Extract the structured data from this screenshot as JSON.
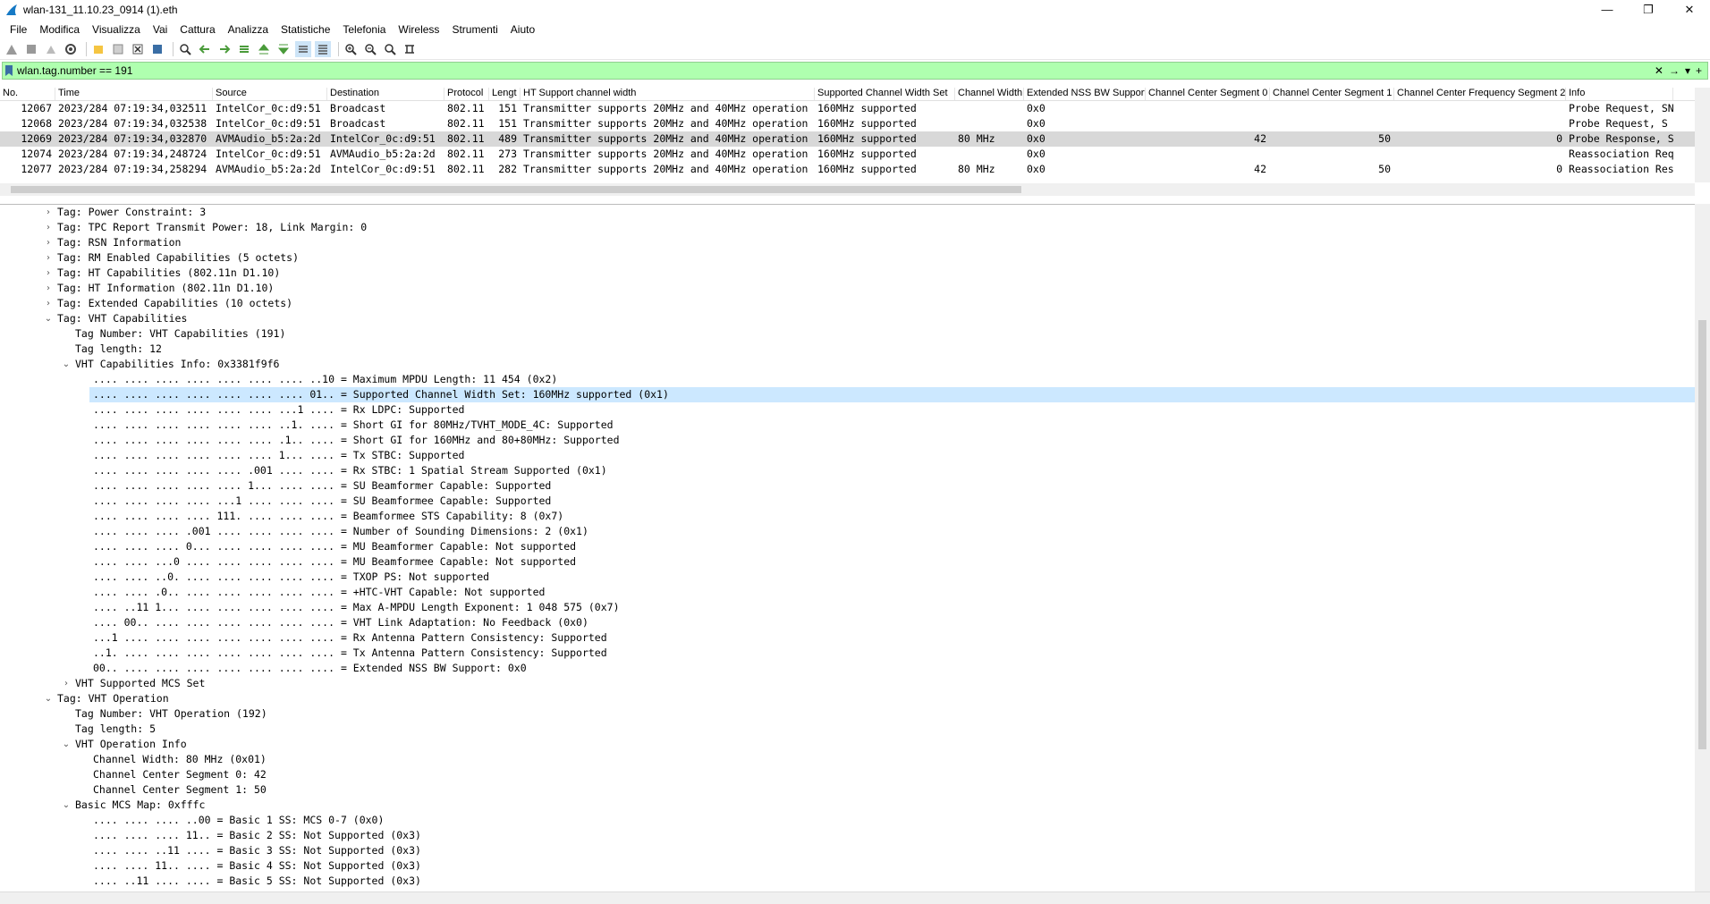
{
  "window": {
    "title": "wlan-131_11.10.23_0914 (1).eth",
    "minimize": "—",
    "restore": "❐",
    "close": "✕"
  },
  "menu": [
    "File",
    "Modifica",
    "Visualizza",
    "Vai",
    "Cattura",
    "Analizza",
    "Statistiche",
    "Telefonia",
    "Wireless",
    "Strumenti",
    "Aiuto"
  ],
  "toolbar_icons": [
    "shark-fin-start-icon",
    "stop-icon",
    "restart-icon",
    "options-gear-icon",
    "open-folder-icon",
    "save-icon",
    "close-file-icon",
    "reload-icon",
    "find-icon",
    "back-arrow-icon",
    "forward-arrow-icon",
    "go-to-packet-icon",
    "first-packet-icon",
    "last-packet-icon",
    "autoscroll-icon",
    "colorize-icon",
    "zoom-in-icon",
    "zoom-out-icon",
    "normal-size-icon",
    "resize-columns-icon"
  ],
  "filter": {
    "value": "wlan.tag.number == 191",
    "clear": "✕",
    "apply": "→",
    "dropdown": "▾",
    "add": "+"
  },
  "packet_list": {
    "headers": [
      "No.",
      "Time",
      "Source",
      "Destination",
      "Protocol",
      "Lengt",
      "HT Support channel width",
      "Supported Channel Width Set",
      "Channel Width",
      "Extended NSS BW Support",
      "Channel Center Segment 0",
      "Channel Center Segment 1",
      "Channel Center Frequency Segment 2",
      "Info"
    ],
    "rows": [
      [
        "12067",
        "2023/284 07:19:34,032511",
        "IntelCor_0c:d9:51",
        "Broadcast",
        "802.11",
        "151",
        "Transmitter supports 20MHz and 40MHz operation",
        "160MHz supported",
        "",
        "0x0",
        "",
        "",
        "",
        "Probe Request, SN"
      ],
      [
        "12068",
        "2023/284 07:19:34,032538",
        "IntelCor_0c:d9:51",
        "Broadcast",
        "802.11",
        "151",
        "Transmitter supports 20MHz and 40MHz operation",
        "160MHz supported",
        "",
        "0x0",
        "",
        "",
        "",
        "Probe Request, S"
      ],
      [
        "12069",
        "2023/284 07:19:34,032870",
        "AVMAudio_b5:2a:2d",
        "IntelCor_0c:d9:51",
        "802.11",
        "489",
        "Transmitter supports 20MHz and 40MHz operation",
        "160MHz supported",
        "80 MHz",
        "0x0",
        "42",
        "50",
        "0",
        "Probe Response, S"
      ],
      [
        "12074",
        "2023/284 07:19:34,248724",
        "IntelCor_0c:d9:51",
        "AVMAudio_b5:2a:2d",
        "802.11",
        "273",
        "Transmitter supports 20MHz and 40MHz operation",
        "160MHz supported",
        "",
        "0x0",
        "",
        "",
        "",
        "Reassociation Req"
      ],
      [
        "12077",
        "2023/284 07:19:34,258294",
        "AVMAudio_b5:2a:2d",
        "IntelCor_0c:d9:51",
        "802.11",
        "282",
        "Transmitter supports 20MHz and 40MHz operation",
        "160MHz supported",
        "80 MHz",
        "0x0",
        "42",
        "50",
        "0",
        "Reassociation Res"
      ]
    ]
  },
  "detail_lines": [
    {
      "indent": 0,
      "arrow": "›",
      "text": "Tag: Power Constraint: 3"
    },
    {
      "indent": 0,
      "arrow": "›",
      "text": "Tag: TPC Report Transmit Power: 18, Link Margin: 0"
    },
    {
      "indent": 0,
      "arrow": "›",
      "text": "Tag: RSN Information"
    },
    {
      "indent": 0,
      "arrow": "›",
      "text": "Tag: RM Enabled Capabilities (5 octets)"
    },
    {
      "indent": 0,
      "arrow": "›",
      "text": "Tag: HT Capabilities (802.11n D1.10)"
    },
    {
      "indent": 0,
      "arrow": "›",
      "text": "Tag: HT Information (802.11n D1.10)"
    },
    {
      "indent": 0,
      "arrow": "›",
      "text": "Tag: Extended Capabilities (10 octets)"
    },
    {
      "indent": 0,
      "arrow": "⌄",
      "text": "Tag: VHT Capabilities"
    },
    {
      "indent": 1,
      "arrow": "",
      "text": "Tag Number: VHT Capabilities (191)"
    },
    {
      "indent": 1,
      "arrow": "",
      "text": "Tag length: 12"
    },
    {
      "indent": 1,
      "arrow": "⌄",
      "text": "VHT Capabilities Info: 0x3381f9f6"
    },
    {
      "indent": 2,
      "arrow": "",
      "text": ".... .... .... .... .... .... .... ..10 = Maximum MPDU Length: 11 454 (0x2)"
    },
    {
      "indent": 2,
      "arrow": "",
      "text": ".... .... .... .... .... .... .... 01.. = Supported Channel Width Set: 160MHz supported (0x1)",
      "sel": true
    },
    {
      "indent": 2,
      "arrow": "",
      "text": ".... .... .... .... .... .... ...1 .... = Rx LDPC: Supported"
    },
    {
      "indent": 2,
      "arrow": "",
      "text": ".... .... .... .... .... .... ..1. .... = Short GI for 80MHz/TVHT_MODE_4C: Supported"
    },
    {
      "indent": 2,
      "arrow": "",
      "text": ".... .... .... .... .... .... .1.. .... = Short GI for 160MHz and 80+80MHz: Supported"
    },
    {
      "indent": 2,
      "arrow": "",
      "text": ".... .... .... .... .... .... 1... .... = Tx STBC: Supported"
    },
    {
      "indent": 2,
      "arrow": "",
      "text": ".... .... .... .... .... .001 .... .... = Rx STBC: 1 Spatial Stream Supported (0x1)"
    },
    {
      "indent": 2,
      "arrow": "",
      "text": ".... .... .... .... .... 1... .... .... = SU Beamformer Capable: Supported"
    },
    {
      "indent": 2,
      "arrow": "",
      "text": ".... .... .... .... ...1 .... .... .... = SU Beamformee Capable: Supported"
    },
    {
      "indent": 2,
      "arrow": "",
      "text": ".... .... .... .... 111. .... .... .... = Beamformee STS Capability: 8 (0x7)"
    },
    {
      "indent": 2,
      "arrow": "",
      "text": ".... .... .... .001 .... .... .... .... = Number of Sounding Dimensions: 2 (0x1)"
    },
    {
      "indent": 2,
      "arrow": "",
      "text": ".... .... .... 0... .... .... .... .... = MU Beamformer Capable: Not supported"
    },
    {
      "indent": 2,
      "arrow": "",
      "text": ".... .... ...0 .... .... .... .... .... = MU Beamformee Capable: Not supported"
    },
    {
      "indent": 2,
      "arrow": "",
      "text": ".... .... ..0. .... .... .... .... .... = TXOP PS: Not supported"
    },
    {
      "indent": 2,
      "arrow": "",
      "text": ".... .... .0.. .... .... .... .... .... = +HTC-VHT Capable: Not supported"
    },
    {
      "indent": 2,
      "arrow": "",
      "text": ".... ..11 1... .... .... .... .... .... = Max A-MPDU Length Exponent: 1 048 575 (0x7)"
    },
    {
      "indent": 2,
      "arrow": "",
      "text": ".... 00.. .... .... .... .... .... .... = VHT Link Adaptation: No Feedback (0x0)"
    },
    {
      "indent": 2,
      "arrow": "",
      "text": "...1 .... .... .... .... .... .... .... = Rx Antenna Pattern Consistency: Supported"
    },
    {
      "indent": 2,
      "arrow": "",
      "text": "..1. .... .... .... .... .... .... .... = Tx Antenna Pattern Consistency: Supported"
    },
    {
      "indent": 2,
      "arrow": "",
      "text": "00.. .... .... .... .... .... .... .... = Extended NSS BW Support: 0x0"
    },
    {
      "indent": 1,
      "arrow": "›",
      "text": "VHT Supported MCS Set"
    },
    {
      "indent": 0,
      "arrow": "⌄",
      "text": "Tag: VHT Operation"
    },
    {
      "indent": 1,
      "arrow": "",
      "text": "Tag Number: VHT Operation (192)"
    },
    {
      "indent": 1,
      "arrow": "",
      "text": "Tag length: 5"
    },
    {
      "indent": 1,
      "arrow": "⌄",
      "text": "VHT Operation Info"
    },
    {
      "indent": 2,
      "arrow": "",
      "text": "Channel Width: 80 MHz (0x01)"
    },
    {
      "indent": 2,
      "arrow": "",
      "text": "Channel Center Segment 0: 42"
    },
    {
      "indent": 2,
      "arrow": "",
      "text": "Channel Center Segment 1: 50"
    },
    {
      "indent": 1,
      "arrow": "⌄",
      "text": "Basic MCS Map: 0xfffc"
    },
    {
      "indent": 2,
      "arrow": "",
      "text": ".... .... .... ..00 = Basic 1 SS: MCS 0-7 (0x0)"
    },
    {
      "indent": 2,
      "arrow": "",
      "text": ".... .... .... 11.. = Basic 2 SS: Not Supported (0x3)"
    },
    {
      "indent": 2,
      "arrow": "",
      "text": ".... .... ..11 .... = Basic 3 SS: Not Supported (0x3)"
    },
    {
      "indent": 2,
      "arrow": "",
      "text": ".... .... 11.. .... = Basic 4 SS: Not Supported (0x3)"
    },
    {
      "indent": 2,
      "arrow": "",
      "text": ".... ..11 .... .... = Basic 5 SS: Not Supported (0x3)"
    }
  ]
}
